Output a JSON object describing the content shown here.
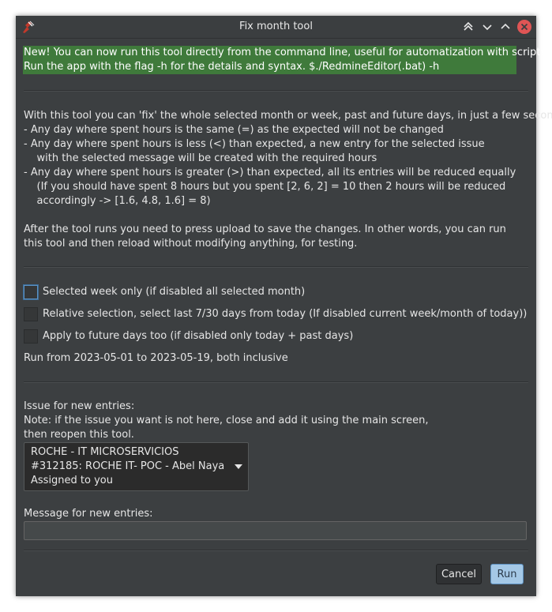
{
  "window": {
    "title": "Fix month tool"
  },
  "notice": {
    "line1": "New! You can now run this tool directly from the command line, useful for automatization with scripts.",
    "line2": "Run the app with the flag -h for the details and syntax.    $./RedmineEditor(.bat) -h"
  },
  "description": {
    "lines": [
      "With this tool you can 'fix' the whole selected month or week, past and future days, in just a few seconds:",
      "- Any day where spent hours is the same (=) as the expected will not be changed",
      "- Any day where spent hours is less (<) than expected, a new entry for the selected issue",
      "    with the selected message will be created with the required hours",
      "- Any day where spent hours is greater (>) than expected, all its entries will be reduced equally",
      "    (If you should have spent 8 hours but you spent [2, 6, 2] = 10 then 2 hours will be reduced",
      "    accordingly -> [1.6, 4.8, 1.6] = 8)"
    ],
    "after_lines": [
      "After the tool runs you need to press upload to save the changes. In other words, you can run",
      "this tool and then reload without modifying anything, for testing."
    ]
  },
  "options": {
    "week_only": {
      "label": "Selected week only (if disabled all selected month)",
      "checked": false
    },
    "relative": {
      "label": "Relative selection, select last 7/30 days from today (If disabled current week/month of today))",
      "checked": false
    },
    "future": {
      "label": "Apply to future days too (if disabled only today + past days)",
      "checked": false
    },
    "range_text": "Run from 2023-05-01 to 2023-05-19, both inclusive"
  },
  "issue": {
    "label": "Issue for new entries:",
    "note1": "Note: if the issue you want is not here, close and add it using the main screen,",
    "note2": "then reopen this tool.",
    "selected": {
      "project": "ROCHE - IT MICROSERVICIOS",
      "issue": "#312185: ROCHE IT- POC - Abel Naya",
      "assigned": "Assigned to you"
    }
  },
  "message": {
    "label": "Message for new entries:",
    "value": ""
  },
  "buttons": {
    "cancel": "Cancel",
    "run": "Run"
  },
  "colors": {
    "background": "#3c3f41",
    "notice_bg": "#3f7a3b",
    "run_button": "#a4c8e6",
    "close_button": "#e05555"
  },
  "icons": {
    "app": "redmine-editor-icon",
    "title_buttons": [
      "keep-above-icon",
      "minimize-icon",
      "maximize-icon",
      "close-icon"
    ]
  }
}
